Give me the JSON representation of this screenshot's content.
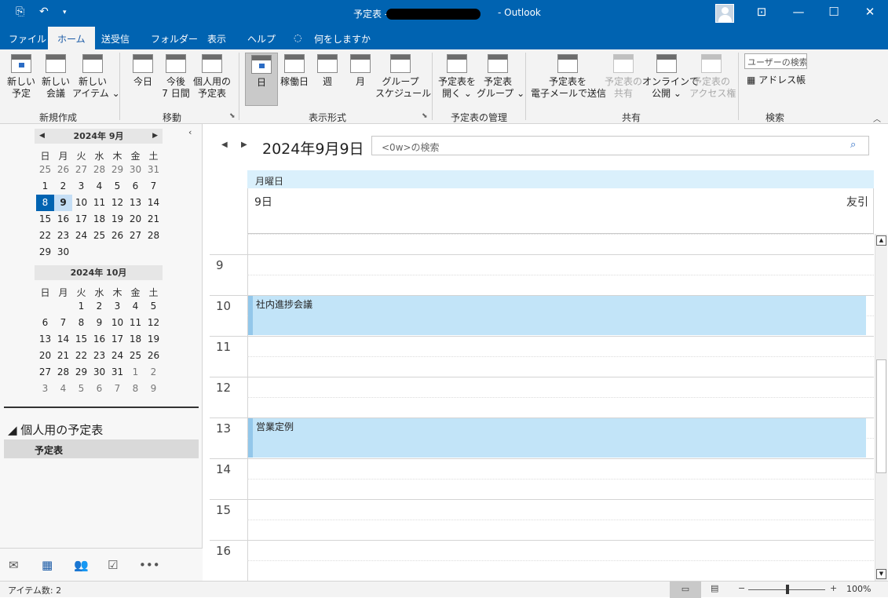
{
  "titlebar": {
    "title_prefix": "予定表 -",
    "title_suffix": "- Outlook",
    "qa_icons": [
      "send-receive-icon",
      "undo-icon",
      "customize-qat-icon"
    ],
    "window_icons": [
      "ribbon-display-options-icon",
      "minimize-icon",
      "maximize-icon",
      "close-icon"
    ],
    "redaction_color": "#000000"
  },
  "menubar": {
    "tabs": [
      "ファイル",
      "ホーム",
      "送受信",
      "フォルダー",
      "表示",
      "ヘルプ"
    ],
    "active_tab": "ホーム",
    "tell_me": "何をしますか",
    "color": "#0063b1"
  },
  "ribbon": {
    "new": {
      "label": "新規作成",
      "new_appointment": "新しい\n予定",
      "new_meeting": "新しい\n会議",
      "new_items": "新しい\nアイテム ⌄"
    },
    "goto": {
      "label": "移動",
      "today": "今日",
      "next7": "今後\n7 日間",
      "personal_cal": "個人用の\n予定表"
    },
    "arrange": {
      "label": "表示形式",
      "day": "日",
      "work_week": "稼働日",
      "week": "週",
      "month": "月",
      "group_schedule": "グループ\nスケジュール",
      "selected": "日"
    },
    "manage": {
      "label": "予定表の管理",
      "open_calendar": "予定表を\n開く ⌄",
      "calendar_groups": "予定表\nグループ ⌄"
    },
    "share": {
      "label": "共有",
      "email_calendar": "予定表を\n電子メールで送信",
      "share_calendar": "予定表の\n共有",
      "publish_online": "オンラインで\n公開 ⌄",
      "calendar_permissions": "予定表の\nアクセス権"
    },
    "find": {
      "label": "検索",
      "search_people": "ユーザーの検索",
      "address_book": "アドレス帳"
    }
  },
  "minical": {
    "months": [
      {
        "title": "2024年 9月",
        "weekdays": [
          "日",
          "月",
          "火",
          "水",
          "木",
          "金",
          "土"
        ],
        "weeks": [
          [
            "25",
            "26",
            "27",
            "28",
            "29",
            "30",
            "31"
          ],
          [
            "1",
            "2",
            "3",
            "4",
            "5",
            "6",
            "7"
          ],
          [
            "8",
            "9",
            "10",
            "11",
            "12",
            "13",
            "14"
          ],
          [
            "15",
            "16",
            "17",
            "18",
            "19",
            "20",
            "21"
          ],
          [
            "22",
            "23",
            "24",
            "25",
            "26",
            "27",
            "28"
          ],
          [
            "29",
            "30",
            "",
            "",
            "",
            "",
            ""
          ]
        ],
        "today": "8",
        "selected": "9"
      },
      {
        "title": "2024年 10月",
        "weekdays": [
          "日",
          "月",
          "火",
          "水",
          "木",
          "金",
          "土"
        ],
        "weeks": [
          [
            "",
            "",
            "1",
            "2",
            "3",
            "4",
            "5"
          ],
          [
            "6",
            "7",
            "8",
            "9",
            "10",
            "11",
            "12"
          ],
          [
            "13",
            "14",
            "15",
            "16",
            "17",
            "18",
            "19"
          ],
          [
            "20",
            "21",
            "22",
            "23",
            "24",
            "25",
            "26"
          ],
          [
            "27",
            "28",
            "29",
            "30",
            "31",
            "1",
            "2"
          ],
          [
            "3",
            "4",
            "5",
            "6",
            "7",
            "8",
            "9"
          ]
        ]
      }
    ]
  },
  "folders": {
    "group": "◢ 個人用の予定表",
    "item": "予定表"
  },
  "nav": [
    "mail-icon",
    "calendar-icon",
    "people-icon",
    "tasks-icon",
    "more-icon"
  ],
  "calendar": {
    "date_title": "2024年9月9日",
    "search_placeholder": "<0w>の検索",
    "weekday": "月曜日",
    "day_number": "9日",
    "rokuyo": "友引",
    "hours": [
      "9",
      "10",
      "11",
      "12",
      "13",
      "14",
      "15",
      "16"
    ],
    "appointments": [
      {
        "title": "社内進捗会議",
        "start": "10:00",
        "end": "11:00"
      },
      {
        "title": "営業定例",
        "start": "13:00",
        "end": "14:00"
      }
    ],
    "appointment_color": "#c2e4f8",
    "dayband_color": "#daf0fc"
  },
  "status": {
    "item_count": "アイテム数: 2",
    "zoom": "100%",
    "zoom_level": 0.5
  }
}
